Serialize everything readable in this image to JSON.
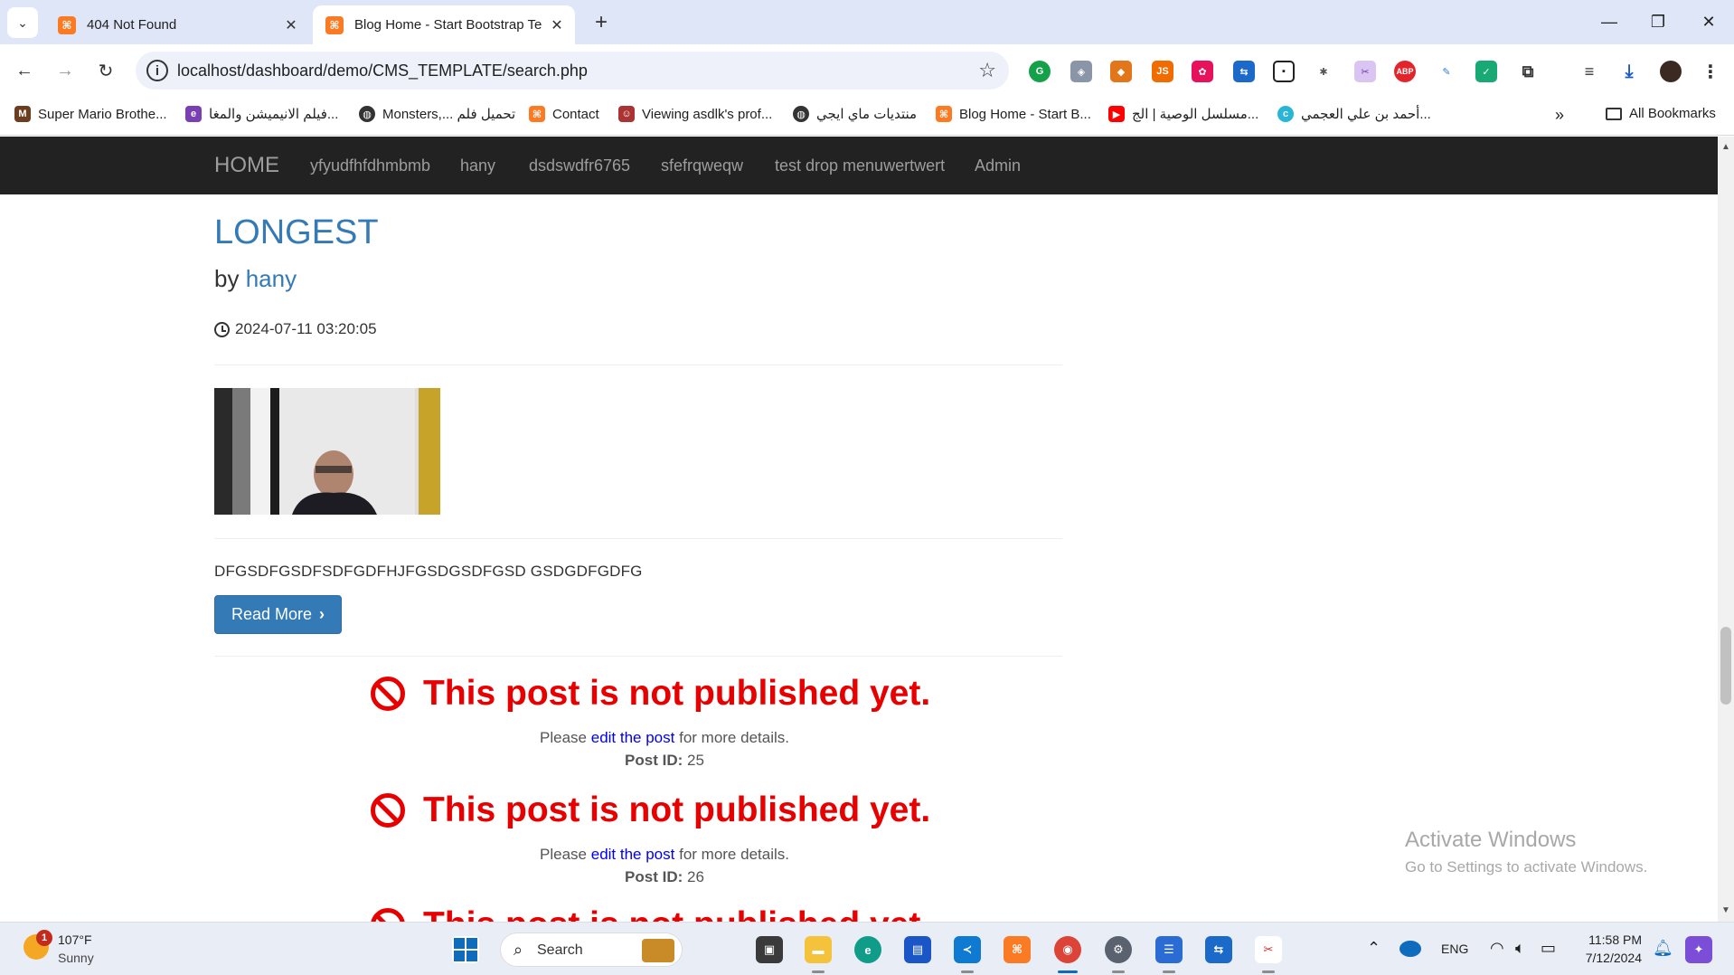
{
  "browser": {
    "tabs": [
      {
        "title": "404 Not Found",
        "favicon": "xampp-icon",
        "active": false
      },
      {
        "title": "Blog Home - Start Bootstrap Te",
        "favicon": "xampp-icon",
        "active": true
      }
    ],
    "address": "localhost/dashboard/demo/CMS_TEMPLATE/search.php",
    "bookmarks": [
      "Super Mario Brothe...",
      "فيلم الانيميشن والمغا...",
      "Monsters,... تحميل فلم",
      "Contact",
      "Viewing asdlk's prof...",
      "منتديات ماي ايجي",
      "Blog Home - Start B...",
      "مسلسل الوصية | الج...",
      "أحمد بن علي العجمي...",
      "All Bookmarks"
    ]
  },
  "page": {
    "navbar": {
      "brand": "HOME",
      "links": [
        "yfyudfhfdhmbmb",
        "hany",
        "dsdswdfr6765",
        "sfefrqweqw",
        "test drop menuwertwert",
        "Admin"
      ]
    },
    "post": {
      "title": "LONGEST",
      "by_prefix": "by",
      "author": "hany",
      "date": "2024-07-11 03:20:05",
      "excerpt": "DFGSDFGSDFSDFGDFHJFGSDGSDFGSD GSDGDFGDFG",
      "read_more": "Read More"
    },
    "unpublished": [
      {
        "message": "This post is not published yet.",
        "please": "Please",
        "link": "edit the post",
        "suffix": "for more details.",
        "id_label": "Post ID:",
        "id": "25"
      },
      {
        "message": "This post is not published yet.",
        "please": "Please",
        "link": "edit the post",
        "suffix": "for more details.",
        "id_label": "Post ID:",
        "id": "26"
      },
      {
        "message": "This post is not published yet."
      }
    ],
    "watermark": {
      "title": "Activate Windows",
      "subtitle": "Go to Settings to activate Windows."
    }
  },
  "taskbar": {
    "weather_temp": "107°F",
    "weather_desc": "Sunny",
    "weather_badge": "1",
    "search": "Search",
    "lang": "ENG",
    "time": "11:58 PM",
    "date": "7/12/2024"
  },
  "colors": {
    "link": "#337ab7",
    "navbar": "#222222",
    "error": "#e80000"
  }
}
